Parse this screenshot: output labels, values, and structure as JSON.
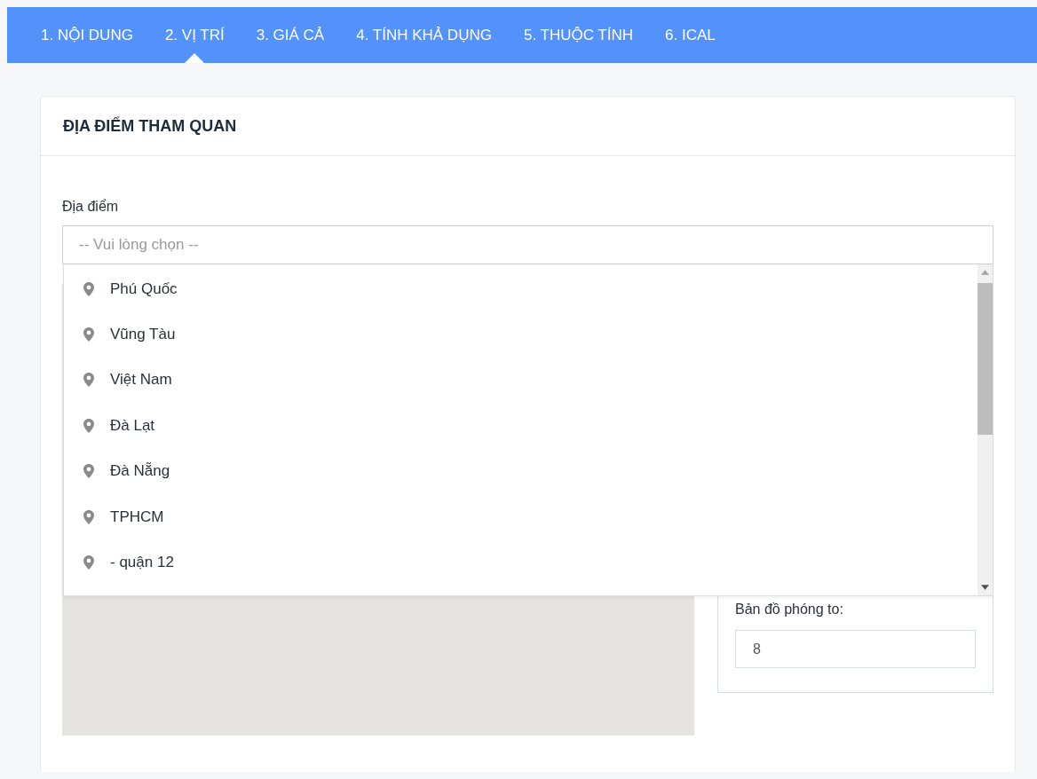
{
  "tabs": [
    {
      "label": "1. NỘI DUNG",
      "selected": false
    },
    {
      "label": "2. VỊ TRÍ",
      "selected": true
    },
    {
      "label": "3. GIÁ CẢ",
      "selected": false
    },
    {
      "label": "4. TÍNH KHẢ DỤNG",
      "selected": false
    },
    {
      "label": "5. THUỘC TÍNH",
      "selected": false
    },
    {
      "label": "6. ICAL",
      "selected": false
    }
  ],
  "section": {
    "title": "ĐỊA ĐIỂM THAM QUAN"
  },
  "location": {
    "label": "Địa điểm",
    "placeholder": "-- Vui lòng chọn --",
    "expanded": true,
    "options": [
      {
        "label": "Phú Quốc"
      },
      {
        "label": "Vũng Tàu"
      },
      {
        "label": "Việt Nam"
      },
      {
        "label": "Đà Lạt"
      },
      {
        "label": "Đà Nẵng"
      },
      {
        "label": "TPHCM"
      },
      {
        "label": "- quận 12"
      }
    ]
  },
  "zoom": {
    "label": "Bản đồ phóng to:",
    "value": "8"
  }
}
